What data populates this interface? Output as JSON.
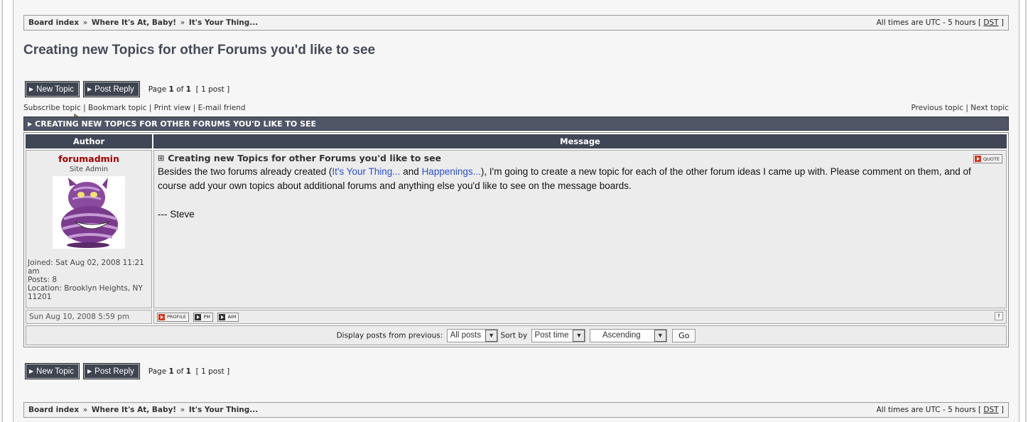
{
  "breadcrumb": {
    "items": [
      "Board index",
      "Where It's At, Baby!",
      "It's Your Thing..."
    ],
    "separator": "»",
    "timezone_prefix": "All times are UTC - 5 hours [ ",
    "timezone_link": "DST",
    "timezone_suffix": " ]"
  },
  "topic": {
    "title": "Creating new Topics for other Forums you'd like to see",
    "bar_title": "CREATING NEW TOPICS FOR OTHER FORUMS YOU'D LIKE TO SEE"
  },
  "buttons": {
    "new_topic": "New Topic",
    "post_reply": "Post Reply"
  },
  "pagination": {
    "page_label": "Page",
    "current": "1",
    "of_label": "of",
    "total": "1",
    "count": "[ 1 post ]"
  },
  "topic_links": {
    "subscribe": "Subscribe topic",
    "bookmark": "Bookmark topic",
    "print": "Print view",
    "email": "E-mail friend",
    "previous": "Previous topic",
    "next": "Next topic",
    "sep": " | "
  },
  "table": {
    "author_header": "Author",
    "message_header": "Message"
  },
  "post": {
    "author": "forumadmin",
    "rank": "Site Admin",
    "joined": "Joined: Sat Aug 02, 2008 11:21 am",
    "posts": "Posts: 8",
    "location": "Location: Brooklyn Heights, NY 11201",
    "subject": "Creating new Topics for other Forums you'd like to see",
    "quote_label": "QUOTE",
    "body_start": "Besides the two forums already created (",
    "link1": "It's Your Thing...",
    "body_and": " and ",
    "link2": "Happenings...",
    "body_rest": "), I'm going to create a new topic for each of the other forum ideas I came up with. Please comment on them, and of course add your own topics about additional forums and anything else you'd like to see on the message boards.",
    "signature": "--- Steve",
    "date": "Sun Aug 10, 2008 5:59 pm",
    "profile_label": "PROFILE",
    "pm_label": "PM",
    "aim_label": "AIM",
    "top_label": "↑"
  },
  "display": {
    "label": "Display posts from previous:",
    "posts_value": "All posts",
    "sort_label": "Sort by",
    "sort_value": "Post time",
    "order_value": "Ascending",
    "go": "Go"
  },
  "colors": {
    "header_bg": "#3f4656",
    "username": "#a10000",
    "link": "#2a4fd0"
  }
}
